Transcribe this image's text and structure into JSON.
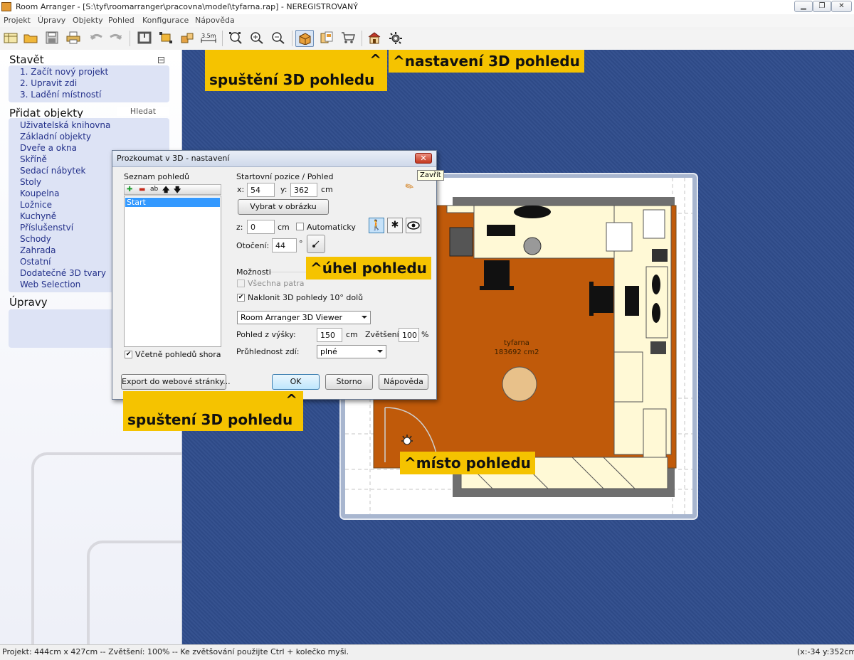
{
  "window": {
    "title": "Room Arranger - [S:\\tyf\\roomarranger\\pracovna\\model\\tyfarna.rap] - NEREGISTROVANÝ",
    "controls": [
      "minimize",
      "restore",
      "close"
    ]
  },
  "menu": [
    "Projekt",
    "Úpravy",
    "Objekty",
    "Pohled",
    "Konfigurace",
    "Nápověda"
  ],
  "toolbar": {
    "icons": [
      "new-project-icon",
      "open-folder-icon",
      "save-icon",
      "print-icon",
      "undo-icon",
      "redo-icon",
      "walls-icon",
      "resize-icon",
      "boxes-icon",
      "measure-icon",
      "zoom-fit-icon",
      "zoom-in-icon",
      "zoom-out-icon",
      "view-3d-icon",
      "catalog-icon",
      "shopping-cart-icon",
      "house-3d-icon",
      "settings-3d-icon"
    ],
    "measure_label": "3.5m"
  },
  "sidebar": {
    "build": {
      "heading": "Stavět",
      "collapse": "−",
      "items": [
        "1. Začít nový projekt",
        "2. Upravit zdi",
        "3. Ladění místností"
      ]
    },
    "add_objects": {
      "heading": "Přidat objekty",
      "search_label": "Hledat",
      "items": [
        "Uživatelská knihovna",
        "Základní objekty",
        "Dveře a okna",
        "Skříně",
        "Sedací nábytek",
        "Stoly",
        "Koupelna",
        "Ložnice",
        "Kuchyně",
        "Příslušenství",
        "Schody",
        "Zahrada",
        "Ostatní",
        "Dodatečné 3D tvary",
        "Web Selection"
      ]
    },
    "edit": {
      "heading": "Úpravy"
    }
  },
  "plan": {
    "room_name": "tyfarna",
    "room_area": "183692 cm2",
    "colors": {
      "floor": "#c05a0a",
      "furniture": "#fff9d6",
      "wall": "#6f6f6f",
      "canvas": "#304d8c"
    }
  },
  "dialog": {
    "title": "Prozkoumat v 3D - nastavení",
    "close_tooltip": "Zavřít",
    "views": {
      "label": "Seznam pohledů",
      "tools": [
        "add-icon",
        "remove-icon",
        "rename-icon",
        "move-up-icon",
        "move-down-icon"
      ],
      "rename_text": "ab",
      "items": [
        "Start"
      ],
      "include_top_label": "Včetně pohledů shora",
      "include_top_checked": true
    },
    "start": {
      "label": "Startovní pozice / Pohled",
      "x_label": "x:",
      "x_value": "54",
      "y_label": "y:",
      "y_value": "362",
      "unit": "cm",
      "pick_button": "Vybrat v obrázku",
      "z_label": "z:",
      "z_value": "0",
      "z_unit": "cm",
      "auto_label": "Automaticky",
      "auto_checked": false,
      "rotation_label": "Otočení:",
      "rotation_value": "44",
      "rotation_unit": "°",
      "mode_icons": [
        "walk-icon",
        "fly-icon",
        "look-icon"
      ]
    },
    "options": {
      "label": "Možnosti",
      "all_floors_label": "Všechna patra",
      "all_floors_checked": false,
      "tilt_label": "Naklonit 3D pohledy 10° dolů",
      "tilt_checked": true,
      "viewer_value": "Room Arranger 3D Viewer",
      "height_label": "Pohled z výšky:",
      "height_value": "150",
      "height_unit": "cm",
      "zoom_label": "Zvětšení:",
      "zoom_value": "100",
      "zoom_unit": "%",
      "transparency_label": "Průhlednost zdí:",
      "transparency_value": "plné"
    },
    "buttons": {
      "export": "Export do webové stránky...",
      "ok": "OK",
      "cancel": "Storno",
      "help": "Nápověda"
    }
  },
  "annotations": {
    "launch_toolbar": "spuštění 3D pohledu",
    "launch_toolbar_caret": "^",
    "settings": "^nastavení 3D pohledu",
    "angle": "^úhel pohledu",
    "launch_dialog": "spuštení 3D pohledu",
    "launch_dialog_caret": "^",
    "position": "^místo pohledu"
  },
  "status": {
    "left": "Projekt: 444cm x 427cm -- Zvětšení: 100% -- Ke zvětšování použijte Ctrl + kolečko myši.",
    "right": "(x:-34 y:352cm)"
  }
}
